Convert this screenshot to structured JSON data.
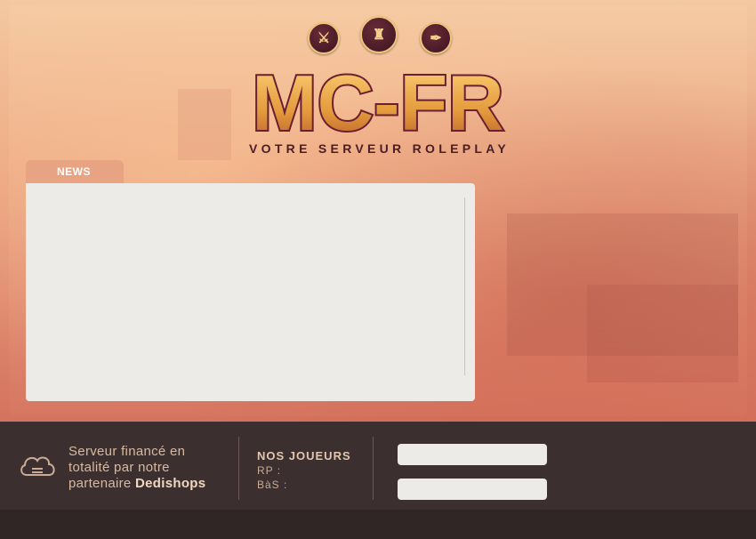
{
  "header": {
    "logo_text": "MC-FR",
    "tagline": "VOTRE SERVEUR ROLEPLAY",
    "icons": [
      "sword-icon",
      "tower-icon",
      "quill-icon"
    ]
  },
  "news": {
    "tab_label": "NEWS"
  },
  "footer": {
    "sponsor_line1": "Serveur financé en",
    "sponsor_line2": "totalité par notre",
    "sponsor_line3_prefix": "partenaire ",
    "sponsor_name": "Dedishops",
    "players_title": "NOS JOUEURS",
    "rp_label": "RP :",
    "bas_label": "BàS :",
    "field1_value": "",
    "field2_value": ""
  },
  "colors": {
    "accent": "#e8a482",
    "footer_bg": "#3b302f",
    "panel_bg": "#ecebe7"
  }
}
